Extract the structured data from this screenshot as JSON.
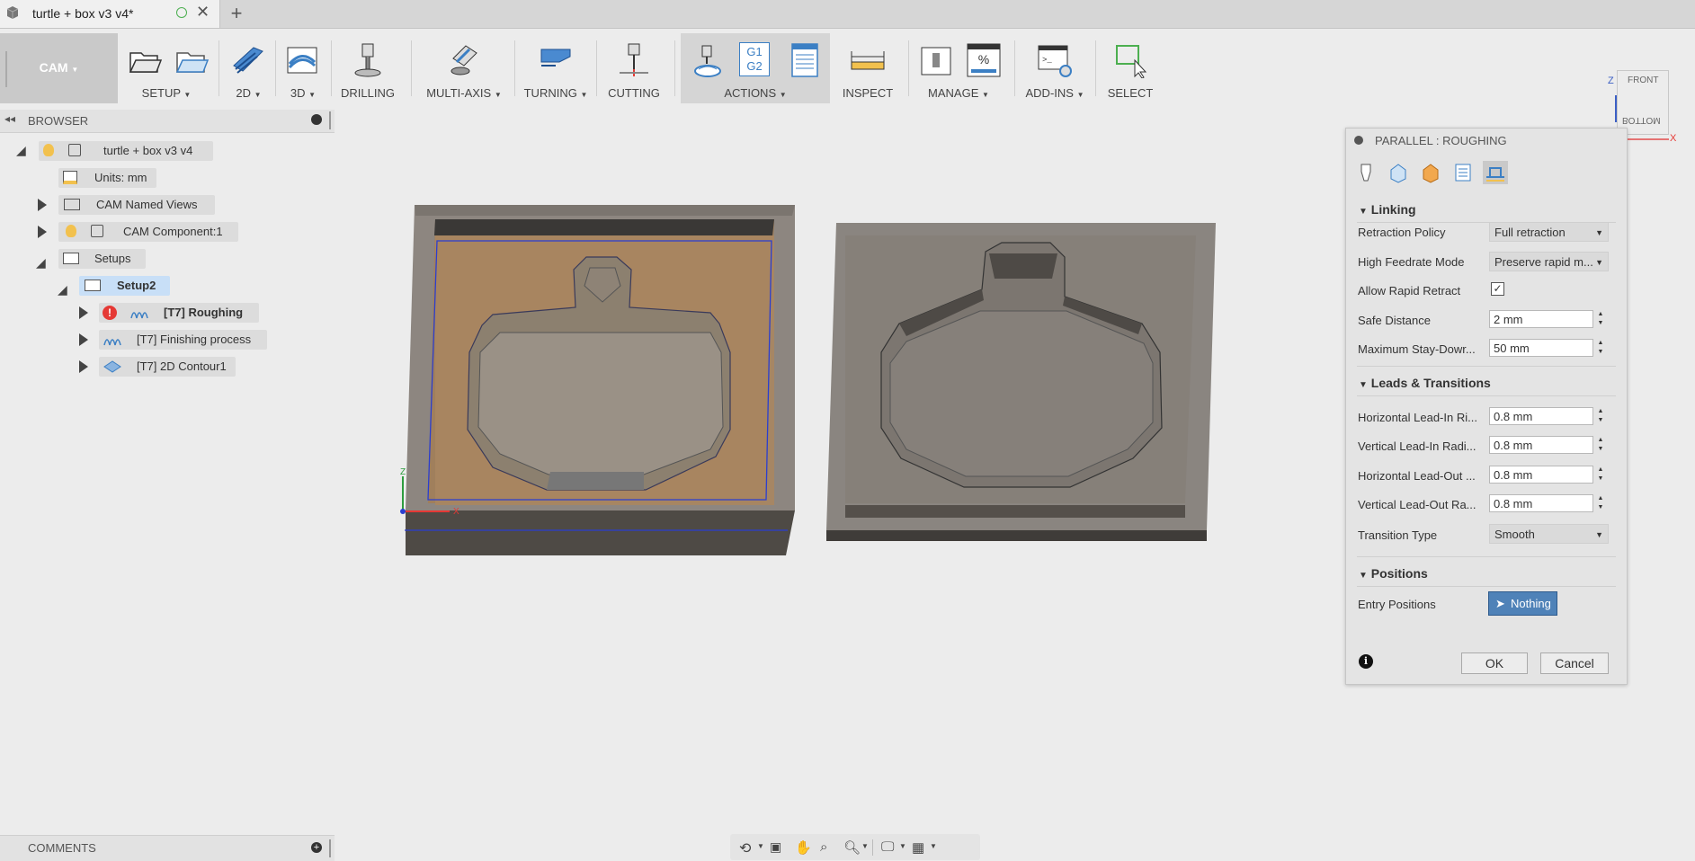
{
  "document": {
    "title": "turtle + box v3 v4*"
  },
  "toolbar": {
    "workspace": "CAM",
    "groups": [
      {
        "label": "SETUP",
        "has_menu": true
      },
      {
        "label": "2D",
        "has_menu": true
      },
      {
        "label": "3D",
        "has_menu": true
      },
      {
        "label": "DRILLING",
        "has_menu": false
      },
      {
        "label": "MULTI-AXIS",
        "has_menu": true
      },
      {
        "label": "TURNING",
        "has_menu": true
      },
      {
        "label": "CUTTING",
        "has_menu": false
      },
      {
        "label": "ACTIONS",
        "has_menu": true
      },
      {
        "label": "INSPECT",
        "has_menu": false
      },
      {
        "label": "MANAGE",
        "has_menu": true
      },
      {
        "label": "ADD-INS",
        "has_menu": true
      },
      {
        "label": "SELECT",
        "has_menu": false
      }
    ],
    "actions_icon_text": [
      "G1",
      "G2"
    ]
  },
  "browser": {
    "title": "BROWSER",
    "nodes": [
      {
        "label": "turtle + box v3 v4"
      },
      {
        "label": "Units: mm"
      },
      {
        "label": "CAM Named Views"
      },
      {
        "label": "CAM Component:1"
      },
      {
        "label": "Setups"
      },
      {
        "label": "Setup2"
      },
      {
        "label": "[T7] Roughing"
      },
      {
        "label": "[T7] Finishing process"
      },
      {
        "label": "[T7] 2D Contour1"
      }
    ]
  },
  "comments": {
    "title": "COMMENTS"
  },
  "viewcube": {
    "front": "FRONT",
    "bottom": "BOTTOM",
    "axis_z": "Z",
    "axis_x": "X"
  },
  "triad": {
    "z": "Z",
    "x": "X"
  },
  "panel": {
    "title": "PARALLEL : ROUGHING",
    "sections": {
      "linking": "Linking",
      "leads": "Leads & Transitions",
      "positions": "Positions"
    },
    "fields": {
      "retraction_policy": {
        "label": "Retraction Policy",
        "value": "Full retraction"
      },
      "high_feedrate_mode": {
        "label": "High Feedrate Mode",
        "value": "Preserve rapid m..."
      },
      "allow_rapid_retract": {
        "label": "Allow Rapid Retract",
        "checked": true
      },
      "safe_distance": {
        "label": "Safe Distance",
        "value": "2 mm"
      },
      "max_stay_down": {
        "label": "Maximum Stay-Dowr...",
        "value": "50 mm"
      },
      "h_lead_in": {
        "label": "Horizontal Lead-In Ri...",
        "value": "0.8 mm"
      },
      "v_lead_in": {
        "label": "Vertical Lead-In Radi...",
        "value": "0.8 mm"
      },
      "h_lead_out": {
        "label": "Horizontal Lead-Out ...",
        "value": "0.8 mm"
      },
      "v_lead_out": {
        "label": "Vertical Lead-Out Ra...",
        "value": "0.8 mm"
      },
      "transition_type": {
        "label": "Transition Type",
        "value": "Smooth"
      },
      "entry_positions": {
        "label": "Entry Positions",
        "value": "Nothing"
      }
    },
    "ok": "OK",
    "cancel": "Cancel"
  }
}
